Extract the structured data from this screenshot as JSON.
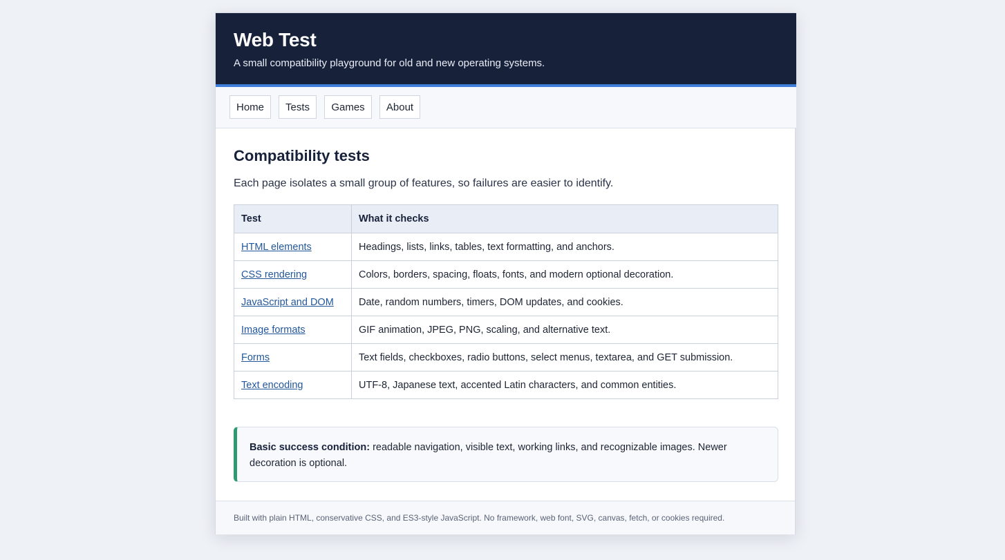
{
  "header": {
    "title": "Web Test",
    "tagline": "A small compatibility playground for old and new operating systems."
  },
  "nav": {
    "items": [
      {
        "label": "Home"
      },
      {
        "label": "Tests"
      },
      {
        "label": "Games"
      },
      {
        "label": "About"
      }
    ]
  },
  "main": {
    "heading": "Compatibility tests",
    "intro": "Each page isolates a small group of features, so failures are easier to identify.",
    "table": {
      "headers": [
        "Test",
        "What it checks"
      ],
      "rows": [
        {
          "test": "HTML elements",
          "checks": "Headings, lists, links, tables, text formatting, and anchors."
        },
        {
          "test": "CSS rendering",
          "checks": "Colors, borders, spacing, floats, fonts, and modern optional decoration."
        },
        {
          "test": "JavaScript and DOM",
          "checks": "Date, random numbers, timers, DOM updates, and cookies."
        },
        {
          "test": "Image formats",
          "checks": "GIF animation, JPEG, PNG, scaling, and alternative text."
        },
        {
          "test": "Forms",
          "checks": "Text fields, checkboxes, radio buttons, select menus, textarea, and GET submission."
        },
        {
          "test": "Text encoding",
          "checks": "UTF-8, Japanese text, accented Latin characters, and common entities."
        }
      ]
    },
    "note": {
      "label": "Basic success condition:",
      "text": " readable navigation, visible text, working links, and recognizable images. Newer decoration is optional."
    }
  },
  "footer": {
    "text": "Built with plain HTML, conservative CSS, and ES3-style JavaScript. No framework, web font, SVG, canvas, fetch, or cookies required."
  },
  "colors": {
    "header_bg": "#17213a",
    "accent_blue": "#3f7fdb",
    "link": "#23579b",
    "success_green": "#2f9a70",
    "page_bg": "#eef1f6"
  }
}
